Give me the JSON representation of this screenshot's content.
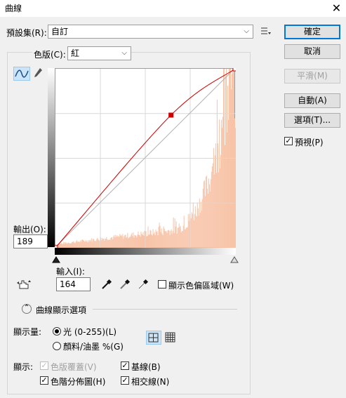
{
  "window": {
    "title": "曲線",
    "close_glyph": "✕"
  },
  "preset": {
    "label": "預設集(R):",
    "value": "自訂"
  },
  "channel": {
    "label": "色版(C):",
    "value": "紅"
  },
  "buttons": {
    "ok": "確定",
    "cancel": "取消",
    "smooth": "平滑(M)",
    "auto": "自動(A)",
    "options": "選項(T)..."
  },
  "preview": {
    "label": "預視(P)",
    "checked": true
  },
  "output": {
    "label": "輸出(O):",
    "value": "189"
  },
  "input": {
    "label": "輸入(I):",
    "value": "164"
  },
  "show_clipping": {
    "label": "顯示色偏區域(W)",
    "checked": false
  },
  "curve_display": {
    "label": "曲線顯示選項"
  },
  "show_amount": {
    "label": "顯示量:",
    "light": "光 (0-255)(L)",
    "pigment": "顏料/油墨 %(G)",
    "selected": "light"
  },
  "show": {
    "label": "顯示:",
    "channel_overlays": "色版覆蓋(V)",
    "baseline": "基線(B)",
    "histogram": "色階分佈圖(H)",
    "intersection": "相交線(N)"
  },
  "curve": {
    "points": [
      [
        0,
        0
      ],
      [
        164,
        189
      ],
      [
        255,
        255
      ]
    ],
    "histogram_color": "#f7c4a8",
    "curve_color": "#d00000"
  }
}
